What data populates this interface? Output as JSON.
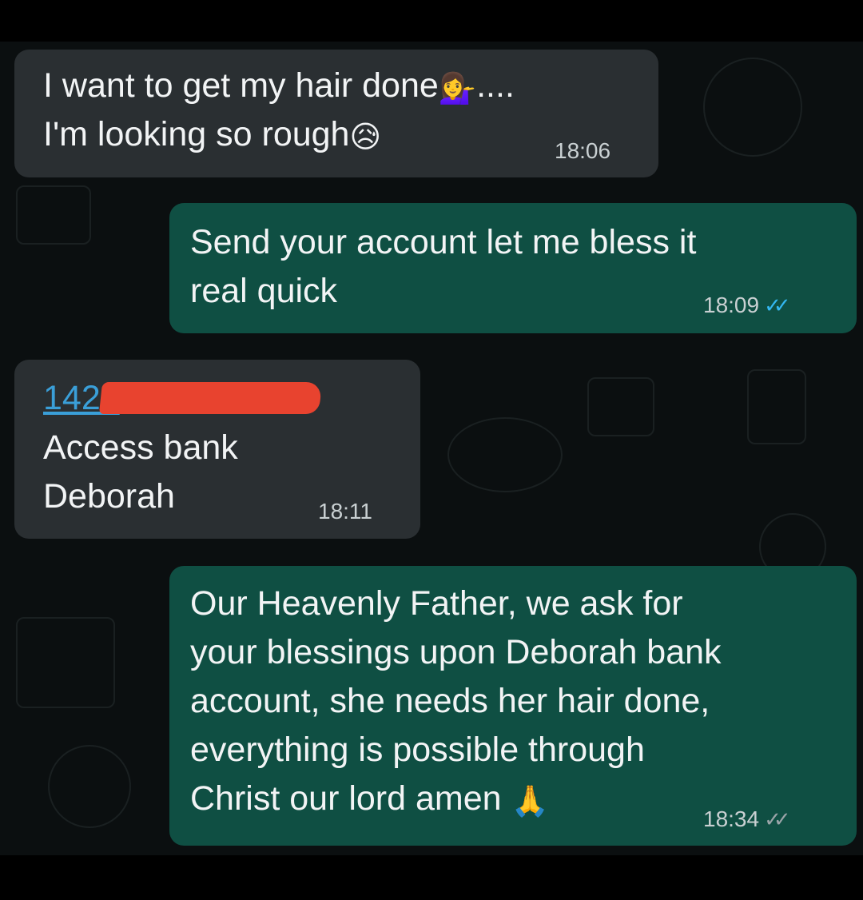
{
  "messages": [
    {
      "direction": "incoming",
      "lines": [
        "I want to get my hair done",
        "I'm looking so rough"
      ],
      "emojis": [
        "💁‍♀️",
        "😥"
      ],
      "suffix": "....",
      "time": "18:06"
    },
    {
      "direction": "outgoing",
      "lines": [
        "Send your account let me bless it",
        "real quick"
      ],
      "time": "18:09",
      "ticks": "✓✓",
      "read": true
    },
    {
      "direction": "incoming",
      "account_prefix": "1428",
      "lines": [
        "Access bank",
        "Deborah"
      ],
      "time": "18:11"
    },
    {
      "direction": "outgoing",
      "lines": [
        "Our Heavenly Father, we ask for",
        "your blessings upon Deborah bank",
        "account, she needs her hair done,",
        "everything is possible through",
        "Christ our lord amen"
      ],
      "emojis": [
        "🙏"
      ],
      "time": "18:34",
      "ticks": "✓✓",
      "read": false
    }
  ],
  "colors": {
    "incoming_bubble": "#2a2f32",
    "outgoing_bubble": "#0f4f43",
    "read_ticks": "#34b7f1",
    "redaction": "#e8432f"
  }
}
